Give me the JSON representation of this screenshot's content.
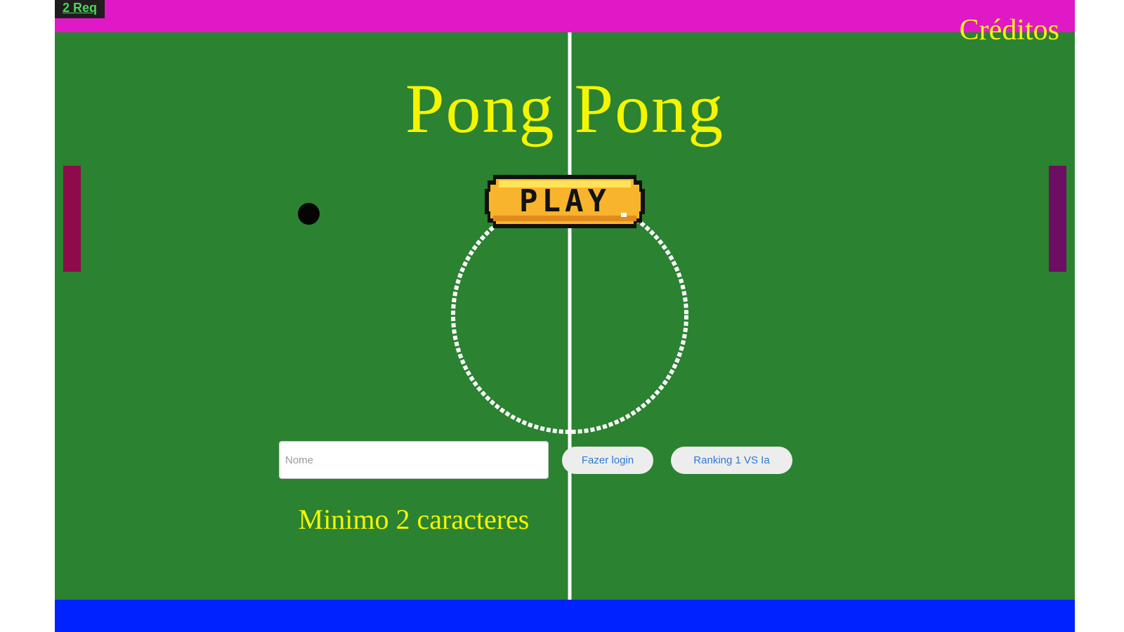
{
  "app": {
    "request_badge": "2 Req",
    "credits_link": "Créditos",
    "title": "Pong Pong"
  },
  "game": {
    "play_button_label": "PLAY",
    "colors": {
      "top_bar": "#e019c6",
      "field": "#2b8231",
      "bottom_bar": "#0022ff",
      "field_lines": "#ffffff",
      "title_text": "#f5f500",
      "left_paddle": "#8d0b4a",
      "right_paddle": "#6e0e63",
      "ball": "#050505",
      "play_button": "#f7b42c"
    }
  },
  "login": {
    "name_placeholder": "Nome",
    "name_value": "",
    "login_button_label": "Fazer login",
    "ranking_button_label": "Ranking 1 VS Ia",
    "hint_text": "Minimo 2 caracteres"
  }
}
